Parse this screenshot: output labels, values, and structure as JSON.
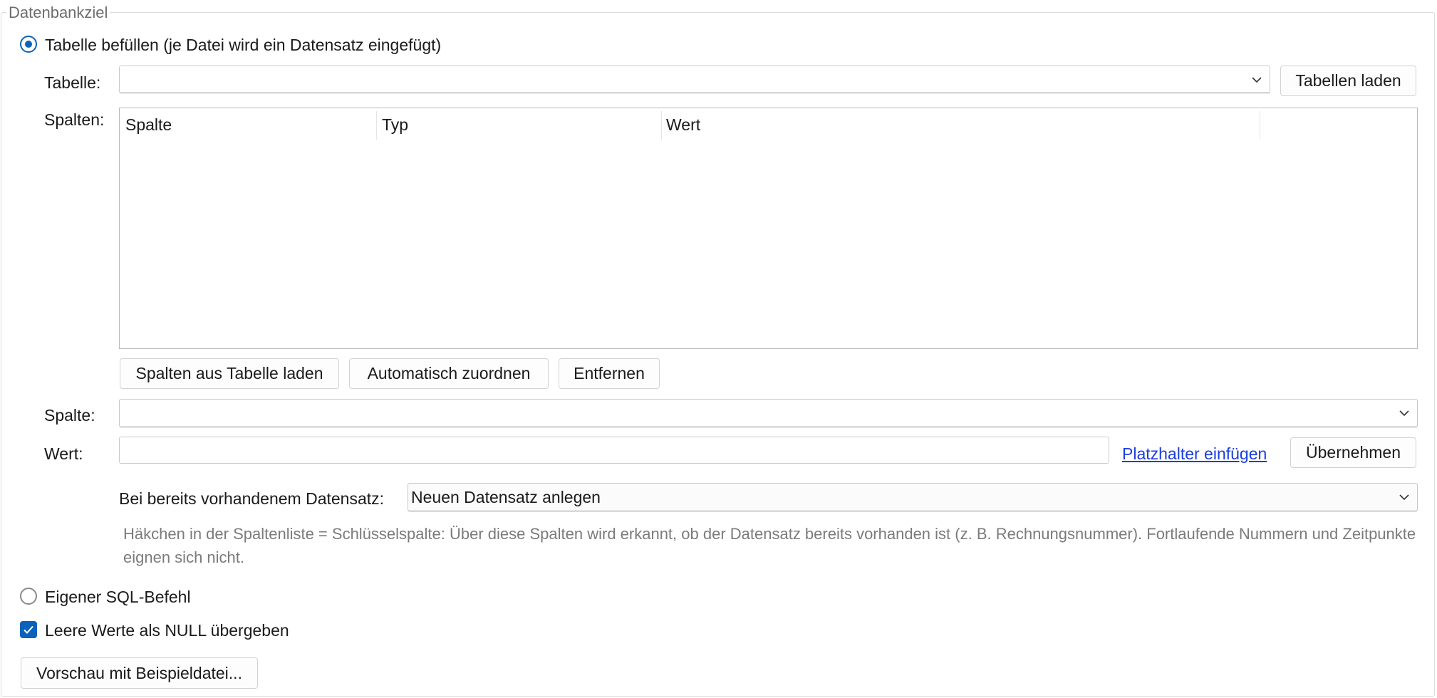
{
  "group": {
    "title": "Datenbankziel"
  },
  "mode_table": {
    "label": "Tabelle befüllen (je Datei wird ein Datensatz eingefügt)",
    "selected": true
  },
  "table": {
    "label": "Tabelle:",
    "value": "",
    "load_button": "Tabellen laden"
  },
  "columns": {
    "label": "Spalten:",
    "headers": [
      "Spalte",
      "Typ",
      "Wert"
    ],
    "rows": [],
    "buttons": {
      "load_from_table": "Spalten aus Tabelle laden",
      "auto_assign": "Automatisch zuordnen",
      "remove": "Entfernen"
    }
  },
  "column_select": {
    "label": "Spalte:",
    "value": ""
  },
  "value_field": {
    "label": "Wert:",
    "value": "",
    "placeholder_link": "Platzhalter einfügen",
    "apply_button": "Übernehmen"
  },
  "existing_record": {
    "label": "Bei bereits vorhandenem Datensatz:",
    "value": "Neuen Datensatz anlegen"
  },
  "hint": "Häkchen in der Spaltenliste = Schlüsselspalte: Über diese Spalten wird erkannt, ob der Datensatz bereits vorhanden ist (z. B. Rechnungsnummer). Fortlaufende Nummern und Zeitpunkte eignen sich nicht.",
  "mode_sql": {
    "label": "Eigener SQL-Befehl",
    "selected": false
  },
  "null_option": {
    "label": "Leere Werte als NULL übergeben",
    "checked": true
  },
  "preview_button": "Vorschau mit Beispieldatei...",
  "colors": {
    "accent": "#0a62b9",
    "link": "#1a3de0",
    "hint": "#7b7b7b"
  },
  "icons": {
    "combo": "chevron-down-icon",
    "check": "checkmark-icon"
  }
}
